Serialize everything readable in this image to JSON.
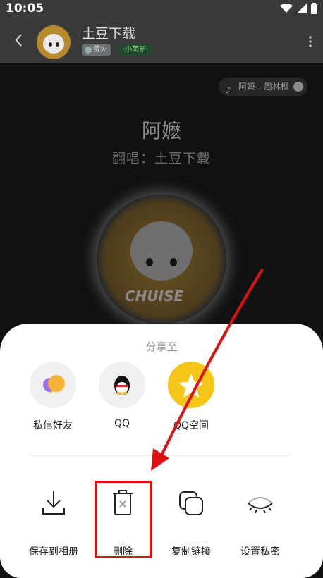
{
  "status_bar": {
    "time": "10:05",
    "icons": [
      "wifi-icon",
      "signal-icon",
      "battery-icon"
    ]
  },
  "header": {
    "title": "土豆下载",
    "badge_level": "萤火",
    "badge_new": "·小萌新·"
  },
  "player": {
    "song_chip": "阿嬷 - 周林枫",
    "song_title": "阿嬷",
    "cover_by": "翻唱：土豆下载",
    "disc_text": "CHUISE"
  },
  "share_sheet": {
    "title": "分享至",
    "share_targets": [
      {
        "label": "私信好友",
        "icon": "chat-bubbles-icon",
        "color": "#f0f0f2"
      },
      {
        "label": "QQ",
        "icon": "qq-penguin-icon",
        "color": "#f0f0f2"
      },
      {
        "label": "QQ空间",
        "icon": "qzone-star-icon",
        "color": "#f5c518"
      }
    ],
    "actions": [
      {
        "label": "保存到相册",
        "icon": "download-icon"
      },
      {
        "label": "删除",
        "icon": "trash-icon"
      },
      {
        "label": "复制链接",
        "icon": "copy-icon"
      },
      {
        "label": "设置私密",
        "icon": "eye-closed-icon"
      }
    ]
  },
  "colors": {
    "annotation": "#e01010",
    "qzone": "#f5c518"
  }
}
